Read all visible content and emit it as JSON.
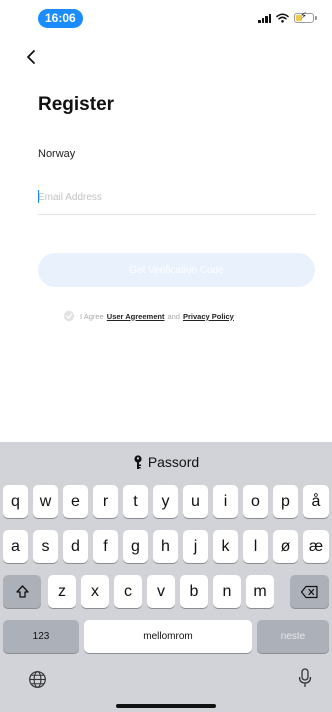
{
  "status_bar": {
    "time": "16:06"
  },
  "page": {
    "title": "Register",
    "country": "Norway",
    "email_placeholder": "Email Address",
    "email_value": "",
    "submit_label": "Get Verification Code",
    "agree_prefix": "I Agree",
    "user_agreement": "User Agreement",
    "agree_and": "and",
    "privacy_policy": "Privacy Policy"
  },
  "keyboard": {
    "suggestion": "Passord",
    "suggestion_icon": "key-icon",
    "row1": [
      "q",
      "w",
      "e",
      "r",
      "t",
      "y",
      "u",
      "i",
      "o",
      "p",
      "å"
    ],
    "row2": [
      "a",
      "s",
      "d",
      "f",
      "g",
      "h",
      "j",
      "k",
      "l",
      "ø",
      "æ"
    ],
    "row3": [
      "z",
      "x",
      "c",
      "v",
      "b",
      "n",
      "m"
    ],
    "numbers_label": "123",
    "space_label": "mellomrom",
    "return_label": "neste"
  },
  "colors": {
    "accent": "#1a8cff",
    "button_disabled": "#e9f1fd",
    "keyboard_bg": "#d1d3d9"
  }
}
